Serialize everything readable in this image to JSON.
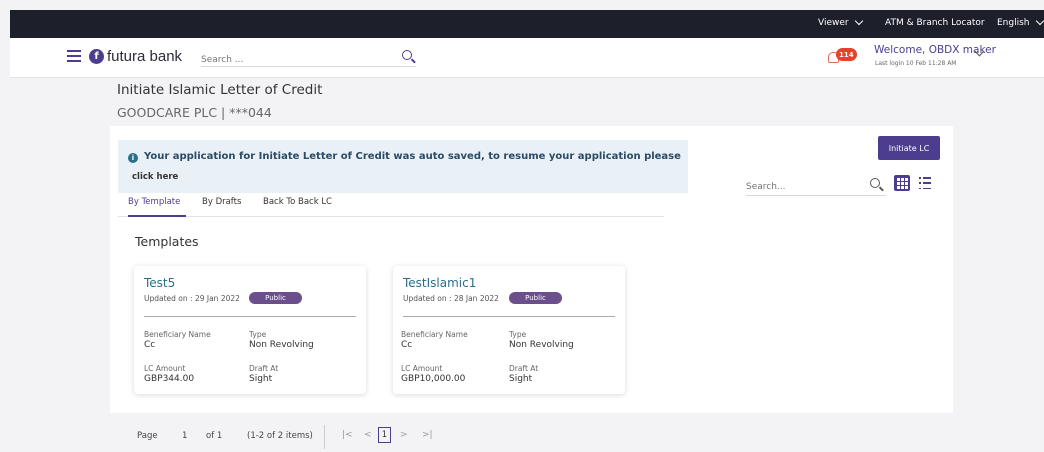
{
  "topbar": {
    "viewer": "Viewer",
    "locator": "ATM & Branch Locator",
    "language": "English"
  },
  "header": {
    "brand": "futura bank",
    "search_placeholder": "Search ...",
    "notification_count": "114",
    "welcome": "Welcome, OBDX maker",
    "last_login": "Last login 10 Feb 11:28 AM"
  },
  "page": {
    "title": "Initiate Islamic Letter of Credit",
    "subtitle": "GOODCARE PLC | ***044",
    "initiate_button": "Initiate LC"
  },
  "banner": {
    "message": "Your application for Initiate Letter of Credit was auto saved, to resume your application please",
    "link": "click here"
  },
  "toolbar": {
    "search_placeholder": "Search..."
  },
  "tabs": [
    {
      "label": "By Template",
      "active": true
    },
    {
      "label": "By Drafts",
      "active": false
    },
    {
      "label": "Back To Back LC",
      "active": false
    }
  ],
  "templates": {
    "heading": "Templates",
    "cards": [
      {
        "name": "Test5",
        "updated": "Updated on : 29 Jan 2022",
        "badge": "Public",
        "beneficiary_label": "Beneficiary Name",
        "beneficiary": "Cc",
        "type_label": "Type",
        "type": "Non Revolving",
        "amount_label": "LC Amount",
        "amount": "GBP344.00",
        "draft_label": "Draft At",
        "draft": "Sight"
      },
      {
        "name": "TestIslamic1",
        "updated": "Updated on : 28 Jan 2022",
        "badge": "Public",
        "beneficiary_label": "Beneficiary Name",
        "beneficiary": "Cc",
        "type_label": "Type",
        "type": "Non Revolving",
        "amount_label": "LC Amount",
        "amount": "GBP10,000.00",
        "draft_label": "Draft At",
        "draft": "Sight"
      }
    ]
  },
  "pagination": {
    "page_label": "Page",
    "page_value": "1",
    "of_label": "of 1",
    "items": "(1-2 of 2 items)",
    "first": "|<",
    "prev": "<",
    "current": "1",
    "next": ">",
    "last": ">|"
  },
  "colors": {
    "brand": "#4c3d8f",
    "topbar": "#1d1f2b",
    "banner": "#e9f1f6",
    "badge": "#6b4e8c",
    "link": "#2a6f8a"
  }
}
